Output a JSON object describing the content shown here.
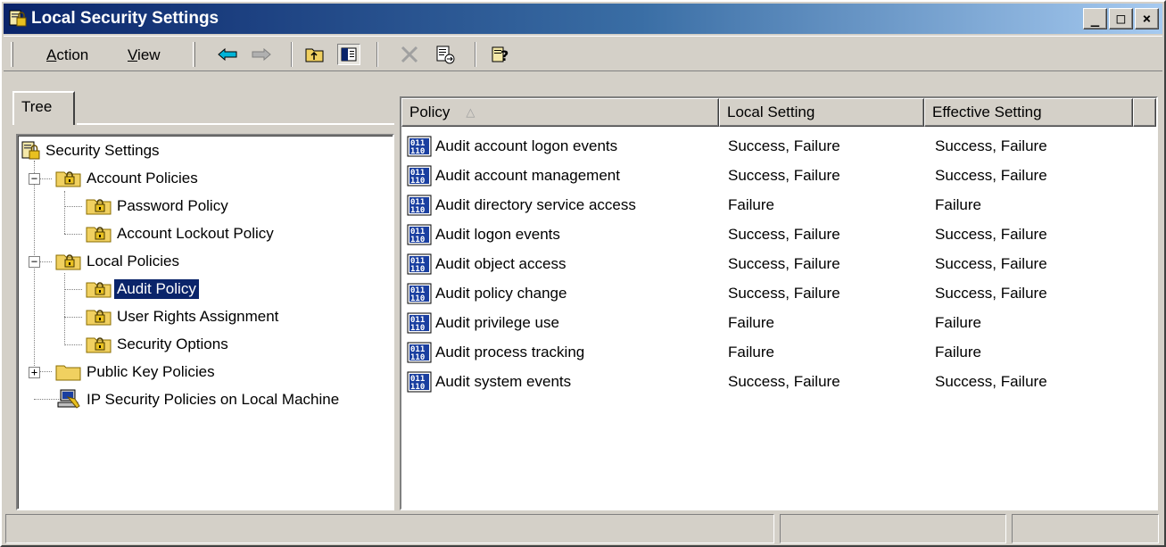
{
  "window": {
    "title": "Local Security Settings",
    "controls": {
      "minimize": "_",
      "maximize": "□",
      "close": "×"
    }
  },
  "menu": {
    "action": {
      "accel": "A",
      "rest": "ction"
    },
    "view": {
      "accel": "V",
      "rest": "iew"
    }
  },
  "toolbar_icons": [
    "back-arrow-icon",
    "forward-arrow-icon",
    "up-folder-icon",
    "show-hide-tree-icon",
    "delete-icon",
    "export-list-icon",
    "help-icon"
  ],
  "tree": {
    "tab_label": "Tree",
    "items": [
      {
        "label": "Security Settings",
        "icon": "security-settings-icon"
      },
      {
        "label": "Account Policies",
        "icon": "folder-lock-icon",
        "expander": "−"
      },
      {
        "label": "Password Policy",
        "icon": "folder-lock-icon"
      },
      {
        "label": "Account Lockout Policy",
        "icon": "folder-lock-icon"
      },
      {
        "label": "Local Policies",
        "icon": "folder-lock-icon",
        "expander": "−"
      },
      {
        "label": "Audit Policy",
        "icon": "folder-lock-icon",
        "selected": true
      },
      {
        "label": "User Rights Assignment",
        "icon": "folder-lock-icon"
      },
      {
        "label": "Security Options",
        "icon": "folder-lock-icon"
      },
      {
        "label": "Public Key Policies",
        "icon": "folder-icon",
        "expander": "+"
      },
      {
        "label": "IP Security Policies on Local Machine",
        "icon": "ip-security-icon"
      }
    ]
  },
  "list": {
    "columns": [
      "Policy",
      "Local Setting",
      "Effective Setting"
    ],
    "sort_indicator": "△",
    "rows": [
      {
        "policy": "Audit account logon events",
        "local": "Success, Failure",
        "effective": "Success, Failure"
      },
      {
        "policy": "Audit account management",
        "local": "Success, Failure",
        "effective": "Success, Failure"
      },
      {
        "policy": "Audit directory service access",
        "local": "Failure",
        "effective": "Failure"
      },
      {
        "policy": "Audit logon events",
        "local": "Success, Failure",
        "effective": "Success, Failure"
      },
      {
        "policy": "Audit object access",
        "local": "Success, Failure",
        "effective": "Success, Failure"
      },
      {
        "policy": "Audit policy change",
        "local": "Success, Failure",
        "effective": "Success, Failure"
      },
      {
        "policy": "Audit privilege use",
        "local": "Failure",
        "effective": "Failure"
      },
      {
        "policy": "Audit process tracking",
        "local": "Failure",
        "effective": "Failure"
      },
      {
        "policy": "Audit system events",
        "local": "Success, Failure",
        "effective": "Success, Failure"
      }
    ]
  },
  "colors": {
    "title_gradient_start": "#0a246a",
    "title_gradient_end": "#a6caf0",
    "selection": "#0a246a",
    "face": "#d4d0c8"
  }
}
